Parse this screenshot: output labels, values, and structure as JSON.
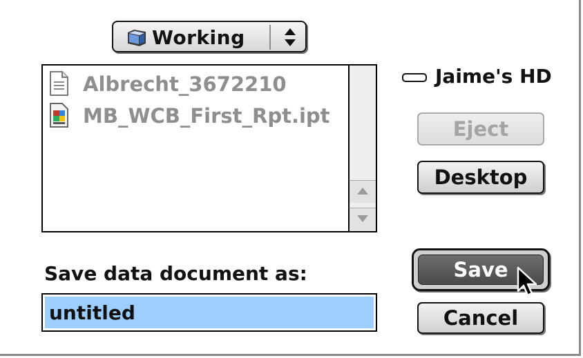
{
  "dialog": {
    "folder_popup": {
      "label": "Working",
      "icon": "folder-icon"
    },
    "file_list": {
      "items": [
        {
          "name": "Albrecht_3672210",
          "icon": "text-document-icon"
        },
        {
          "name": "MB_WCB_First_Rpt.ipt",
          "icon": "application-document-icon"
        }
      ]
    },
    "volume": {
      "name": "Jaime's HD",
      "icon": "hard-disk-icon"
    },
    "buttons": {
      "eject": "Eject",
      "desktop": "Desktop",
      "save": "Save",
      "cancel": "Cancel"
    },
    "prompt_label": "Save data document as:",
    "filename_value": "untitled",
    "colors": {
      "selection": "#9ccfff",
      "default_button": "#4a4a4a",
      "disabled_text": "#a4a4a4"
    }
  }
}
